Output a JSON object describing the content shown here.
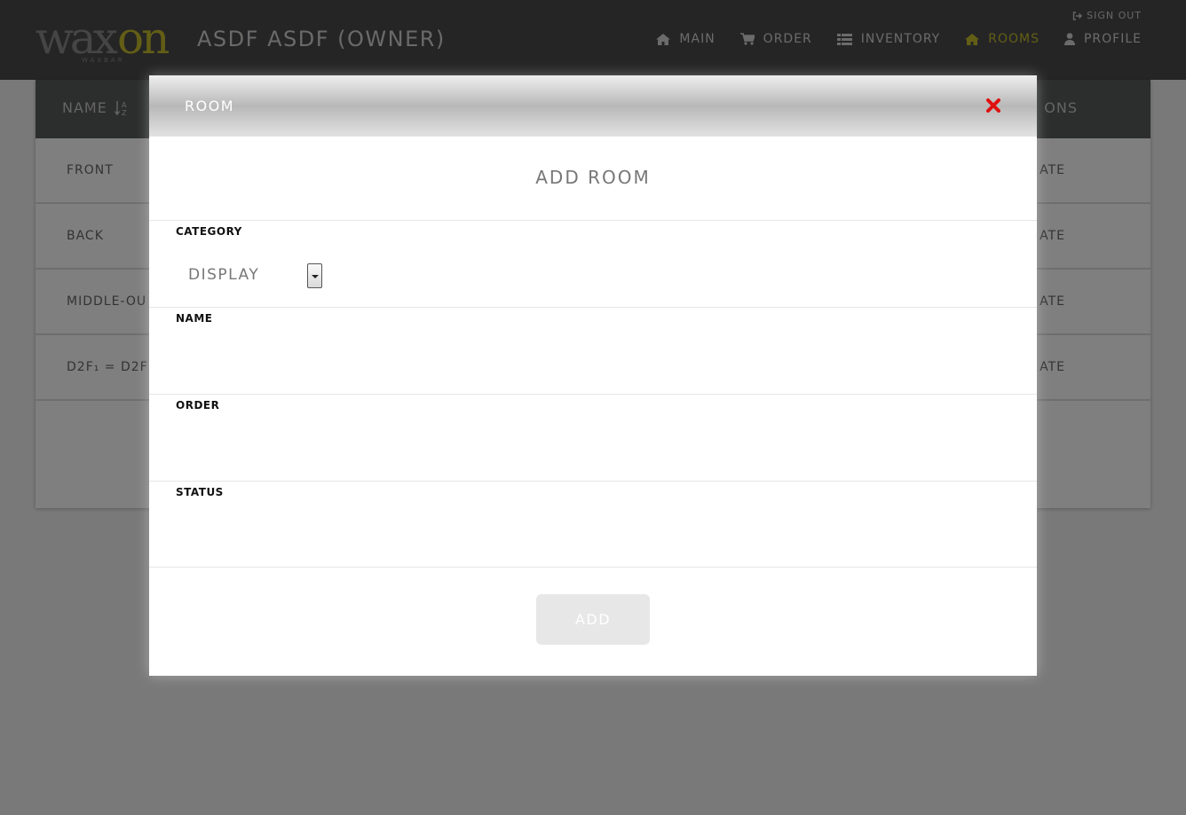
{
  "header": {
    "logo_text_main": "wax",
    "logo_text_accent": "on",
    "logo_subtext": "WAXBAR",
    "owner_title": "ASDF ASDF (OWNER)",
    "sign_out_label": "SIGN OUT",
    "nav": [
      {
        "label": "MAIN",
        "icon": "home-icon",
        "active": false
      },
      {
        "label": "ORDER",
        "icon": "cart-icon",
        "active": false
      },
      {
        "label": "INVENTORY",
        "icon": "list-icon",
        "active": false
      },
      {
        "label": "ROOMS",
        "icon": "home-icon",
        "active": true
      },
      {
        "label": "PROFILE",
        "icon": "user-icon",
        "active": false
      }
    ]
  },
  "table": {
    "columns": {
      "name": "NAME",
      "actions": "ONS"
    },
    "rows": [
      {
        "name": "FRONT",
        "action": "ATE"
      },
      {
        "name": "BACK",
        "action": "ATE"
      },
      {
        "name": "MIDDLE-OU",
        "action": "ATE"
      },
      {
        "name": "D2F₁ = D2F",
        "action": "ATE"
      }
    ]
  },
  "modal": {
    "title": "ROOM",
    "form_title": "ADD ROOM",
    "fields": {
      "category": {
        "label": "CATEGORY",
        "value": "DISPLAY"
      },
      "name": {
        "label": "NAME",
        "value": ""
      },
      "order": {
        "label": "ORDER",
        "value": ""
      },
      "status": {
        "label": "STATUS",
        "value": ""
      }
    },
    "submit_label": "ADD"
  },
  "colors": {
    "accent": "#c7bc2c",
    "header_bg": "#4a4b4c",
    "close": "#e01010"
  }
}
